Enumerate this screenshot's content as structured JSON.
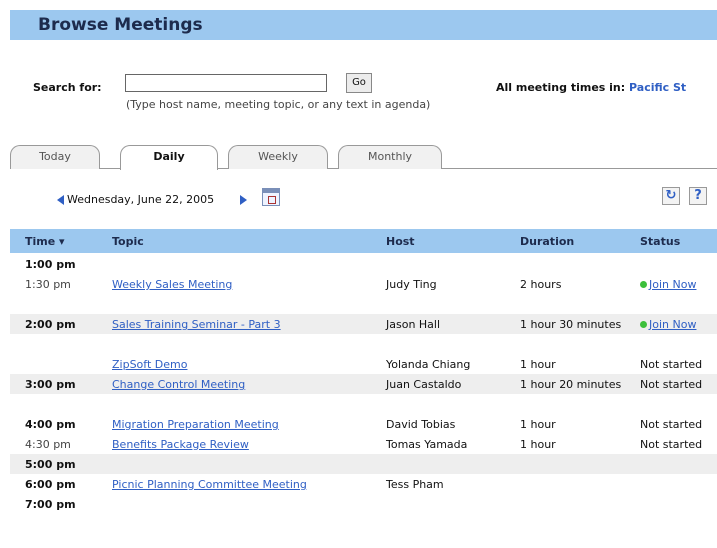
{
  "header": {
    "title": "Browse Meetings"
  },
  "search": {
    "label": "Search for:",
    "value": "",
    "go_label": "Go",
    "hint": "(Type host name, meeting topic, or any text in agenda)"
  },
  "timezone": {
    "label": "All meeting times in:",
    "value": "Pacific St"
  },
  "tabs": [
    {
      "label": "Today"
    },
    {
      "label": "Daily"
    },
    {
      "label": "Weekly"
    },
    {
      "label": "Monthly"
    }
  ],
  "date": {
    "current": "Wednesday, June 22, 2005"
  },
  "table": {
    "columns": [
      "Time ▾",
      "Topic",
      "Host",
      "Duration",
      "Status"
    ],
    "rows": [
      {
        "time": "1:00 pm",
        "topic": "",
        "host": "",
        "duration": "",
        "status": ""
      },
      {
        "time": "1:30 pm",
        "topic": "Weekly Sales Meeting",
        "host": "Judy Ting",
        "duration": "2 hours",
        "status": "Join Now"
      },
      {
        "time": "",
        "topic": "",
        "host": "",
        "duration": "",
        "status": ""
      },
      {
        "time": "2:00 pm",
        "topic": "Sales Training Seminar - Part 3",
        "host": "Jason Hall",
        "duration": "1 hour 30 minutes",
        "status": "Join Now"
      },
      {
        "time": "",
        "topic": "",
        "host": "",
        "duration": "",
        "status": ""
      },
      {
        "time": "",
        "topic": "ZipSoft Demo",
        "host": "Yolanda Chiang",
        "duration": "1 hour",
        "status": "Not started"
      },
      {
        "time": "3:00 pm",
        "topic": "Change Control Meeting",
        "host": "Juan Castaldo",
        "duration": "1 hour 20 minutes",
        "status": "Not started"
      },
      {
        "time": "",
        "topic": "",
        "host": "",
        "duration": "",
        "status": ""
      },
      {
        "time": "4:00 pm",
        "topic": "Migration Preparation Meeting",
        "host": "David Tobias",
        "duration": "1 hour",
        "status": "Not started"
      },
      {
        "time": "4:30 pm",
        "topic": "Benefits Package Review",
        "host": "Tomas Yamada",
        "duration": "1 hour",
        "status": "Not started"
      },
      {
        "time": "5:00 pm",
        "topic": "",
        "host": "",
        "duration": "",
        "status": ""
      },
      {
        "time": "6:00 pm",
        "topic": "Picnic Planning Committee Meeting",
        "host": "Tess Pham",
        "duration": "",
        "status": ""
      },
      {
        "time": "7:00 pm",
        "topic": "",
        "host": "",
        "duration": "",
        "status": ""
      }
    ]
  },
  "colors": {
    "header_bg": "#9cc8ef",
    "link": "#2f5fc4",
    "live": "#3cbf3c",
    "row_shade": "#eeeeee"
  },
  "icons": [
    "calendar-icon",
    "refresh-icon",
    "help-icon",
    "prev-day-icon",
    "next-day-icon"
  ]
}
